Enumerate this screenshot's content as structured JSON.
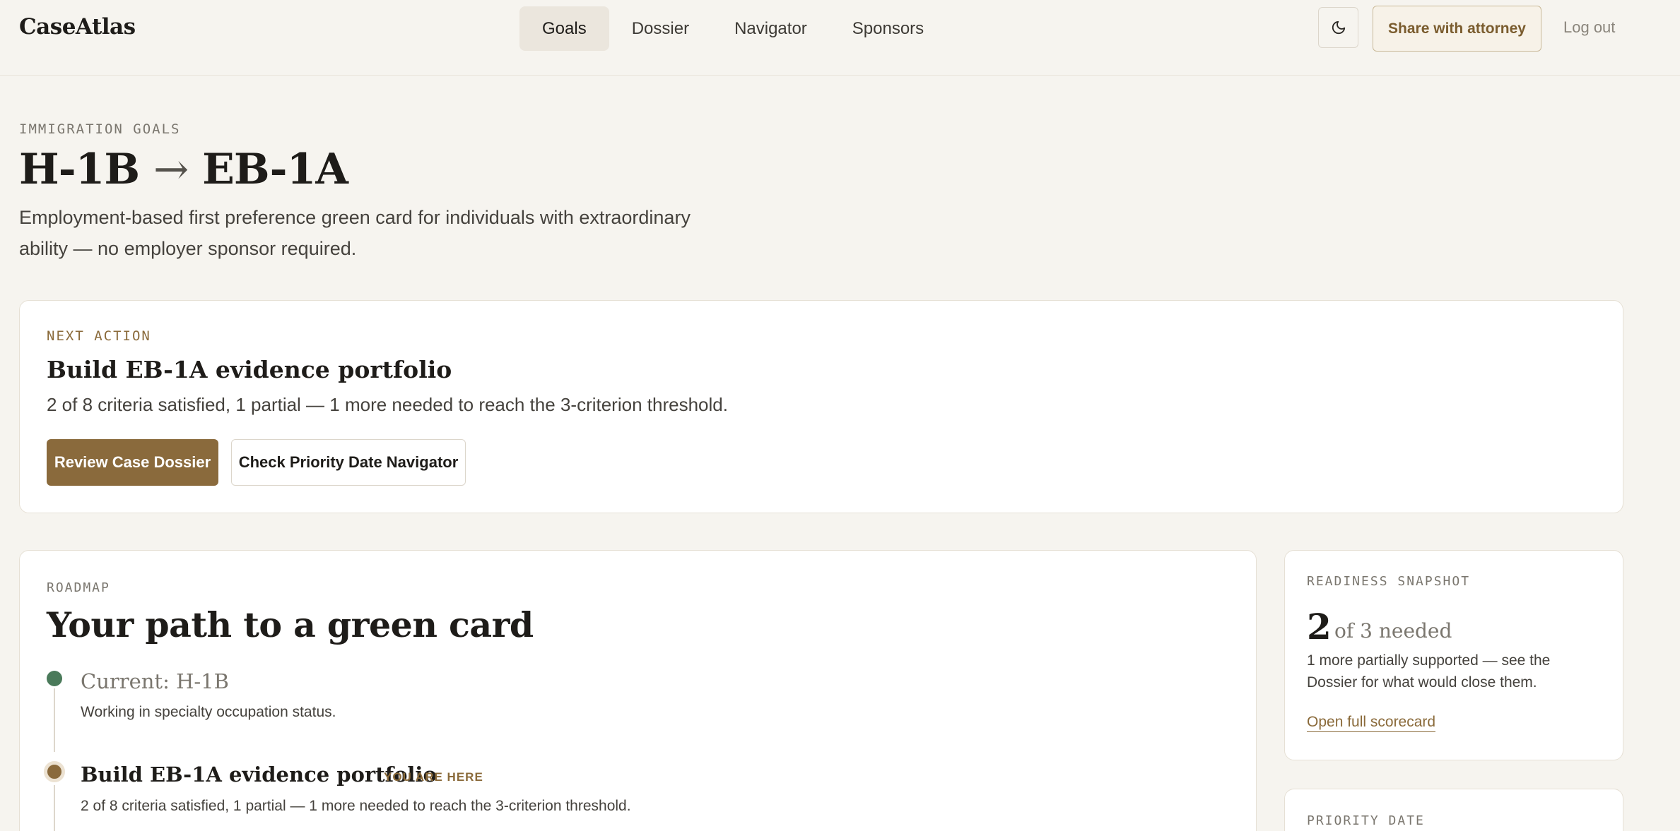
{
  "app": {
    "brand": "CaseAtlas"
  },
  "nav": {
    "items": [
      {
        "label": "Goals",
        "active": true
      },
      {
        "label": "Dossier",
        "active": false
      },
      {
        "label": "Navigator",
        "active": false
      },
      {
        "label": "Sponsors",
        "active": false
      }
    ],
    "theme_icon": "moon-icon",
    "share_label": "Share with attorney",
    "logout_label": "Log out"
  },
  "header": {
    "eyebrow": "IMMIGRATION GOALS",
    "from": "H-1B",
    "arrow": "→",
    "to": "EB-1A",
    "description": "Employment-based first preference green card for individuals with extraordinary ability — no employer sponsor required."
  },
  "next_action": {
    "eyebrow": "NEXT ACTION",
    "title": "Build EB-1A evidence portfolio",
    "description": "2 of 8 criteria satisfied, 1 partial — 1 more needed to reach the 3-criterion threshold.",
    "primary_label": "Review Case Dossier",
    "secondary_label": "Check Priority Date Navigator"
  },
  "roadmap": {
    "eyebrow": "ROADMAP",
    "title": "Your path to a green card",
    "steps": [
      {
        "title": "Current: H-1B",
        "description": "Working in specialty occupation status.",
        "status": "done"
      },
      {
        "title": "Build EB-1A evidence portfolio",
        "tag": "YOU ARE HERE",
        "description": "2 of 8 criteria satisfied, 1 partial — 1 more needed to reach the 3-criterion threshold.",
        "status": "current"
      }
    ]
  },
  "readiness": {
    "eyebrow": "READINESS SNAPSHOT",
    "count": "2",
    "of_needed": "of 3 needed",
    "description": "1 more partially supported — see the Dossier for what would close them.",
    "link_label": "Open full scorecard"
  },
  "priority": {
    "eyebrow": "PRIORITY DATE"
  },
  "colors": {
    "accent": "#8a6a3c",
    "success": "#4a7a5a",
    "background": "#f6f4ef"
  }
}
